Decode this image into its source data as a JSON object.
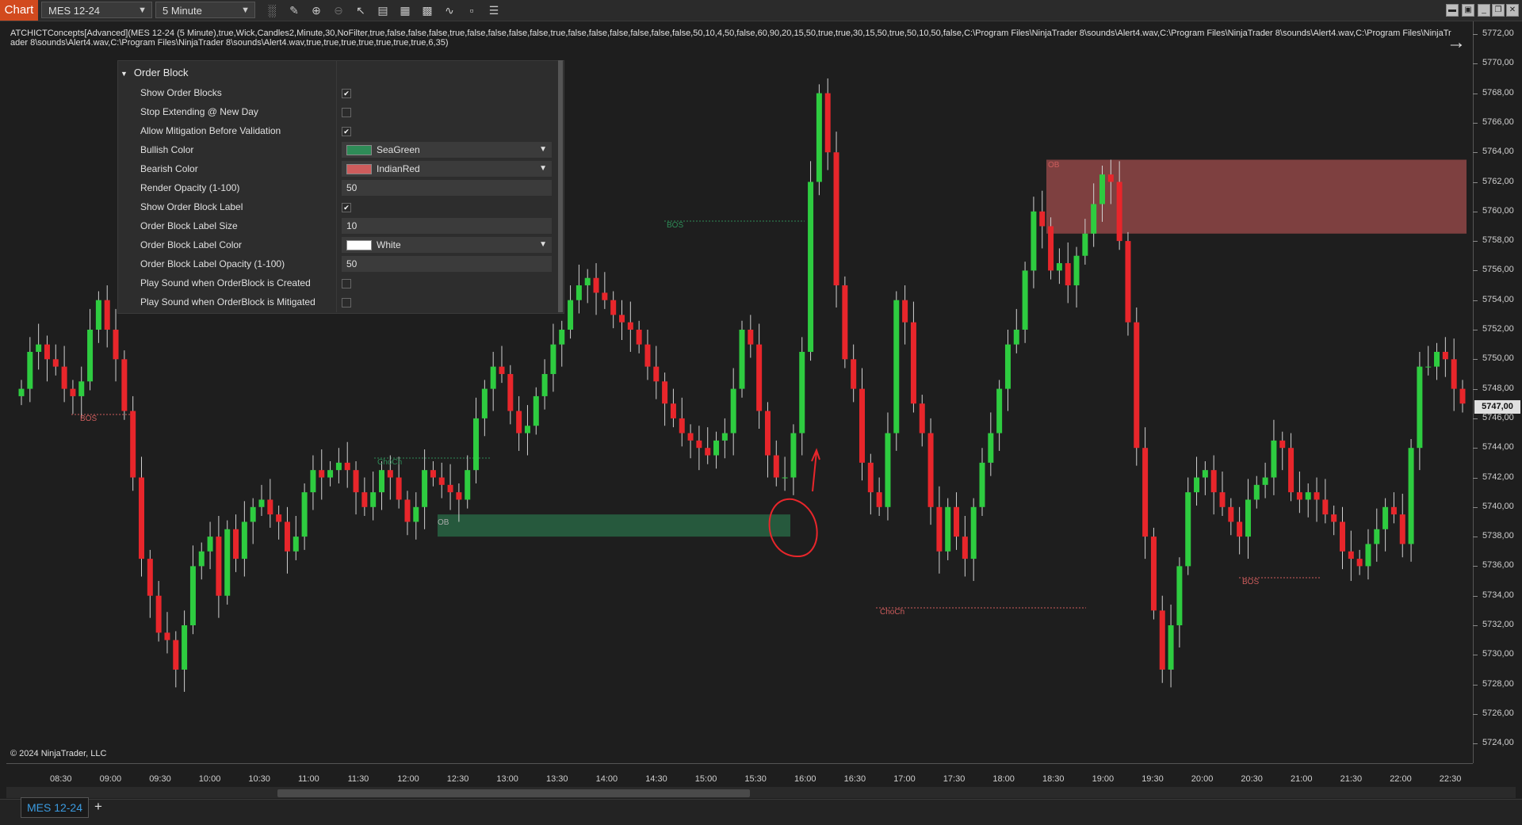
{
  "toolbar": {
    "app_label": "Chart",
    "instrument": "MES 12-24",
    "interval": "5 Minute",
    "icons": [
      "bar-type-icon",
      "draw-pencil-icon",
      "zoom-in-icon",
      "zoom-out-icon",
      "pointer-icon",
      "data-box-icon",
      "properties-icon",
      "strategies-icon",
      "indicators-icon",
      "templates-icon"
    ]
  },
  "indicator_text": "ATCHICTConcepts[Advanced](MES 12-24 (5 Minute),true,Wick,Candles2,Minute,30,NoFilter,true,false,false,false,true,false,false,false,false,true,false,false,false,false,false,false,50,10,4,50,false,60,90,20,15,50,true,true,30,15,50,true,50,10,50,false,C:\\Program Files\\NinjaTrader 8\\sounds\\Alert4.wav,C:\\Program Files\\NinjaTrader 8\\sounds\\Alert4.wav,C:\\Program Files\\NinjaTrader 8\\sounds\\Alert4.wav,C:\\Program Files\\NinjaTrader 8\\sounds\\Alert4.wav,true,true,true,true,true,true,true,6,35)",
  "copyright": "© 2024 NinjaTrader, LLC",
  "panel": {
    "header": "Order Block",
    "rows": [
      {
        "label": "Show Order Blocks",
        "type": "check",
        "checked": true
      },
      {
        "label": "Stop Extending @ New Day",
        "type": "check",
        "checked": false
      },
      {
        "label": "Allow Mitigation Before Validation",
        "type": "check",
        "checked": true
      },
      {
        "label": "Bullish Color",
        "type": "color",
        "value": "SeaGreen",
        "color": "#2e8b57"
      },
      {
        "label": "Bearish Color",
        "type": "color",
        "value": "IndianRed",
        "color": "#cd5c5c"
      },
      {
        "label": "Render Opacity (1-100)",
        "type": "input",
        "value": "50"
      },
      {
        "label": "Show Order Block Label",
        "type": "check",
        "checked": true
      },
      {
        "label": "Order Block Label Size",
        "type": "input",
        "value": "10"
      },
      {
        "label": "Order Block Label Color",
        "type": "color",
        "value": "White",
        "color": "#ffffff"
      },
      {
        "label": "Order Block Label Opacity (1-100)",
        "type": "input",
        "value": "50"
      },
      {
        "label": "Play Sound when OrderBlock is Created",
        "type": "check",
        "checked": false
      },
      {
        "label": "Play Sound when OrderBlock is Mitigated",
        "type": "check",
        "checked": false
      }
    ]
  },
  "price_axis": {
    "labels": [
      "5772,00",
      "5770,00",
      "5768,00",
      "5766,00",
      "5764,00",
      "5762,00",
      "5760,00",
      "5758,00",
      "5756,00",
      "5754,00",
      "5752,00",
      "5750,00",
      "5748,00",
      "5746,00",
      "5744,00",
      "5742,00",
      "5740,00",
      "5738,00",
      "5736,00",
      "5734,00",
      "5732,00",
      "5730,00",
      "5728,00",
      "5726,00",
      "5724,00"
    ],
    "current": "5747,00"
  },
  "time_axis": {
    "labels": [
      "08:30",
      "09:00",
      "09:30",
      "10:00",
      "10:30",
      "11:00",
      "11:30",
      "12:00",
      "12:30",
      "13:00",
      "13:30",
      "14:00",
      "14:30",
      "15:00",
      "15:30",
      "16:00",
      "16:30",
      "17:00",
      "17:30",
      "18:00",
      "18:30",
      "19:00",
      "19:30",
      "20:00",
      "20:30",
      "21:00",
      "21:30",
      "22:00",
      "22:30"
    ]
  },
  "chart_data": {
    "type": "candlestick",
    "instrument": "MES 12-24",
    "interval": "5 Minute",
    "ylim": [
      5723,
      5773
    ],
    "bull_color": "#2ecc40",
    "bear_color": "#e8262b",
    "annotations": {
      "labels": [
        "BOS",
        "ChoCh",
        "OB",
        "BOS",
        "OB",
        "ChoCh",
        "BOS"
      ],
      "bullish_ob": {
        "top": 5739.5,
        "bottom": 5738.0,
        "label": "OB"
      },
      "bearish_ob": {
        "top": 5763.5,
        "bottom": 5758.5,
        "label": "OB"
      }
    },
    "closes": [
      5748.0,
      5750.5,
      5751.0,
      5750.0,
      5749.5,
      5748.0,
      5747.5,
      5748.5,
      5752.0,
      5754.0,
      5752.0,
      5750.0,
      5746.5,
      5742.0,
      5736.5,
      5734.0,
      5731.5,
      5731.0,
      5729.0,
      5732.0,
      5736.0,
      5737.0,
      5738.0,
      5734.0,
      5738.5,
      5736.5,
      5739.0,
      5740.0,
      5740.5,
      5739.5,
      5739.0,
      5737.0,
      5738.0,
      5741.0,
      5742.5,
      5742.0,
      5742.5,
      5743.0,
      5742.5,
      5741.0,
      5740.0,
      5741.0,
      5742.5,
      5742.0,
      5740.5,
      5739.0,
      5740.0,
      5742.5,
      5742.0,
      5741.5,
      5741.0,
      5740.5,
      5742.5,
      5746.0,
      5748.0,
      5749.5,
      5749.0,
      5746.5,
      5745.0,
      5745.5,
      5747.5,
      5749.0,
      5751.0,
      5752.0,
      5754.0,
      5755.0,
      5755.5,
      5754.5,
      5754.0,
      5753.0,
      5752.5,
      5752.0,
      5751.0,
      5749.5,
      5748.5,
      5747.0,
      5746.0,
      5745.0,
      5744.5,
      5744.0,
      5743.5,
      5744.5,
      5745.0,
      5748.0,
      5752.0,
      5751.0,
      5746.5,
      5743.5,
      5742.0,
      5742.0,
      5745.0,
      5750.5,
      5762.0,
      5768.0,
      5764.0,
      5755.0,
      5750.0,
      5748.0,
      5743.0,
      5741.0,
      5740.0,
      5745.0,
      5754.0,
      5752.5,
      5747.0,
      5745.0,
      5740.0,
      5737.0,
      5740.0,
      5738.0,
      5736.5,
      5740.0,
      5743.0,
      5745.0,
      5748.0,
      5751.0,
      5752.0,
      5756.0,
      5760.0,
      5759.0,
      5756.0,
      5756.5,
      5755.0,
      5757.0,
      5758.5,
      5760.5,
      5762.5,
      5762.0,
      5758.0,
      5752.5,
      5744.0,
      5738.0,
      5733.0,
      5729.0,
      5732.0,
      5736.0,
      5741.0,
      5742.0,
      5742.5,
      5741.0,
      5740.0,
      5739.0,
      5738.0,
      5740.5,
      5741.5,
      5742.0,
      5744.5,
      5744.0,
      5741.0,
      5740.5,
      5741.0,
      5740.5,
      5739.5,
      5739.0,
      5737.0,
      5736.5,
      5736.0,
      5737.5,
      5738.5,
      5740.0,
      5739.5,
      5737.5,
      5744.0,
      5749.5,
      5749.5,
      5750.5,
      5750.0,
      5748.0,
      5747.0
    ]
  }
}
